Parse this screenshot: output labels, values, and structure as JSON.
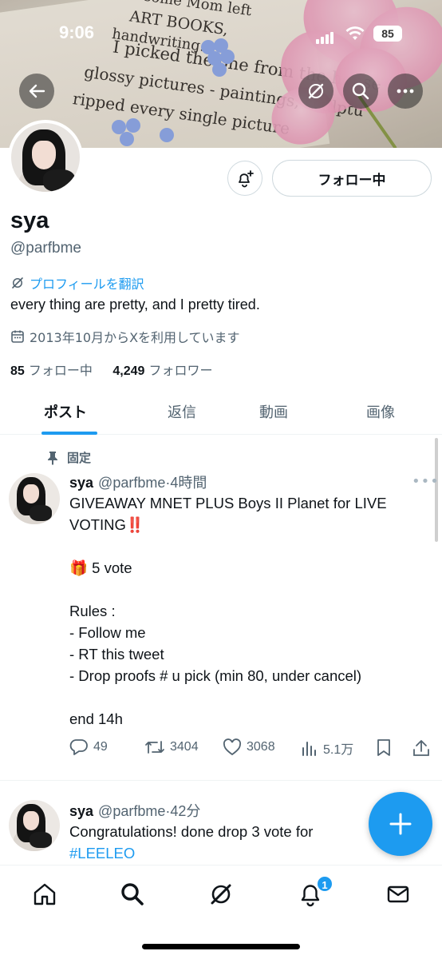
{
  "status_bar": {
    "time": "9:06",
    "battery": "85"
  },
  "banner": {
    "book_lines": [
      "some Mom left",
      "ART BOOKS,",
      "handwriting.",
      "I picked the one from the house",
      "glossy pictures - paintings, sculptu",
      "ripped every single picture"
    ]
  },
  "profile": {
    "name": "sya",
    "handle": "@parfbme",
    "translate": "プロフィールを翻訳",
    "bio": "every thing are pretty, and I pretty tired.",
    "joined": "2013年10月からXを利用しています",
    "following_count": "85",
    "following_label": "フォロー中",
    "followers_count": "4,249",
    "followers_label": "フォロワー",
    "follow_button": "フォロー中"
  },
  "tabs": [
    {
      "label": "ポスト",
      "active": true
    },
    {
      "label": "返信"
    },
    {
      "label": "動画"
    },
    {
      "label": "画像"
    }
  ],
  "pinned_label": "固定",
  "tweets": [
    {
      "name": "sya",
      "handle": "@parfbme",
      "time": "4時間",
      "body": "GIVEAWAY MNET PLUS Boys II Planet for LIVE VOTING‼️\n\n🎁 5 vote\n\nRules :\n- Follow me\n- RT this tweet\n- Drop proofs # u pick (min 80, under cancel)\n\nend 14h",
      "replies": "49",
      "retweets": "3404",
      "likes": "3068",
      "views": "5.1万"
    },
    {
      "name": "sya",
      "handle": "@parfbme",
      "time": "42分",
      "body": "Congratulations! done drop 3 vote for",
      "hashtag": "#LEELEO"
    }
  ],
  "nav": {
    "notification_badge": "1"
  },
  "colors": {
    "accent": "#1d9bf0",
    "text": "#0f1419",
    "muted": "#536471"
  }
}
